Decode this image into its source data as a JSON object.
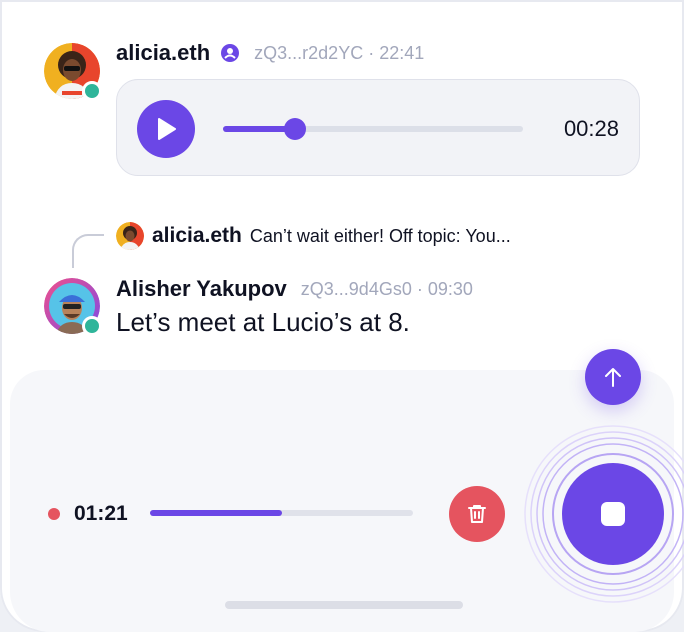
{
  "colors": {
    "accent": "#6b47e6",
    "danger": "#e5545f",
    "online": "#2fb59a",
    "muted": "#a2a7bb"
  },
  "messages": [
    {
      "author": "alicia.eth",
      "verified_icon": "user-badge-icon",
      "meta": "zQ3...r2d2YC · 22:41",
      "audio": {
        "duration": "00:28",
        "progress": 0.24
      }
    },
    {
      "author": "Alisher Yakupov",
      "meta": "zQ3...9d4Gs0 · 09:30",
      "reply_to": {
        "author": "alicia.eth",
        "text": "Can’t wait either! Off topic: You..."
      },
      "text": "Let’s meet at Lucio’s at 8."
    }
  ],
  "composer": {
    "recording_time": "01:21",
    "recording_progress": 0.5,
    "icons": {
      "send": "arrow-up-icon",
      "delete": "trash-icon",
      "stop": "stop-icon"
    }
  }
}
